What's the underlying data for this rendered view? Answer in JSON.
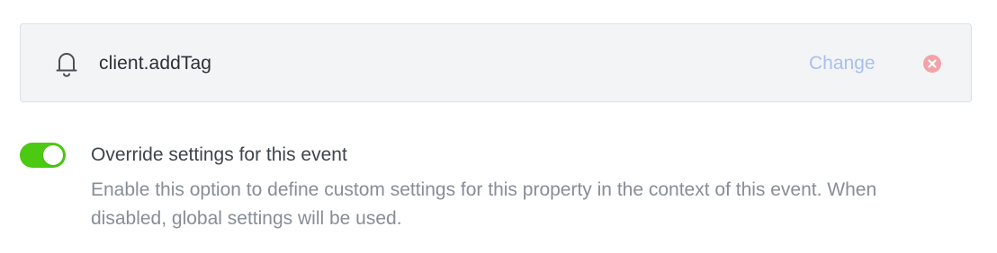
{
  "event": {
    "name": "client.addTag",
    "icon": "bell-icon",
    "change_label": "Change",
    "remove_icon": "close-circle-icon"
  },
  "override": {
    "enabled": true,
    "title": "Override settings for this event",
    "description": "Enable this option to define custom settings for this property in the context of this event. When disabled, global settings will be used."
  },
  "colors": {
    "toggle_on": "#4cc913",
    "link": "#a9bff0",
    "remove": "#f3a3a8",
    "card_bg": "#f3f4f6"
  }
}
